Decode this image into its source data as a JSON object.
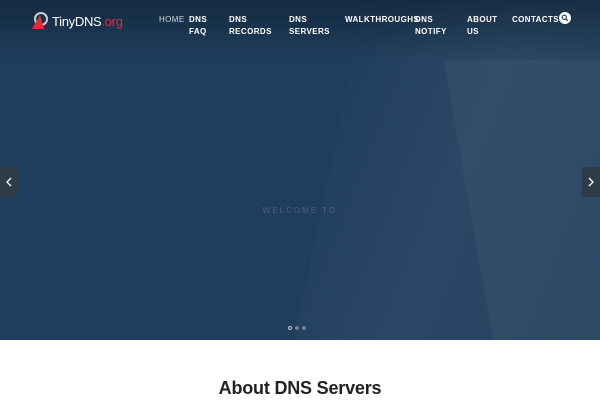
{
  "logo": {
    "name": "TinyDNS",
    "tld": ".org"
  },
  "nav": {
    "items": [
      {
        "label": "HOME",
        "active": true
      },
      {
        "label": "DNS\nFAQ"
      },
      {
        "label": "DNS\nRECORDS"
      },
      {
        "label": "DNS\nSERVERS"
      },
      {
        "label": "WALKTHROUGHS"
      },
      {
        "label": "DNS\nNOTIFY"
      },
      {
        "label": "ABOUT\nUS"
      },
      {
        "label": "CONTACTS"
      }
    ]
  },
  "hero": {
    "welcome": "WELCOME TO",
    "slide_count": 3,
    "active_slide": 1
  },
  "about": {
    "title": "About DNS Servers"
  },
  "icons": {
    "search": "search-icon",
    "prev": "chevron-left-icon",
    "next": "chevron-right-icon",
    "logo": "logo-mark-icon"
  },
  "colors": {
    "hero_bg": "#1f3e5d",
    "accent": "#d8323a",
    "nav_text": "#ffffff"
  }
}
